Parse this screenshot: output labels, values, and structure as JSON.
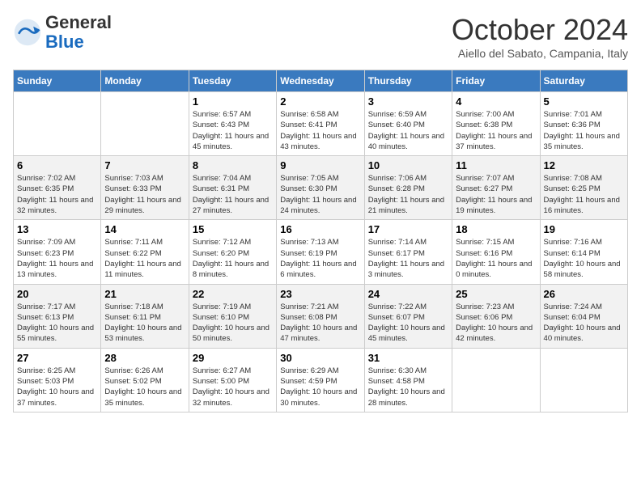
{
  "header": {
    "logo_general": "General",
    "logo_blue": "Blue",
    "month_title": "October 2024",
    "location": "Aiello del Sabato, Campania, Italy"
  },
  "days_of_week": [
    "Sunday",
    "Monday",
    "Tuesday",
    "Wednesday",
    "Thursday",
    "Friday",
    "Saturday"
  ],
  "weeks": [
    [
      {
        "day": "",
        "info": ""
      },
      {
        "day": "",
        "info": ""
      },
      {
        "day": "1",
        "info": "Sunrise: 6:57 AM\nSunset: 6:43 PM\nDaylight: 11 hours and 45 minutes."
      },
      {
        "day": "2",
        "info": "Sunrise: 6:58 AM\nSunset: 6:41 PM\nDaylight: 11 hours and 43 minutes."
      },
      {
        "day": "3",
        "info": "Sunrise: 6:59 AM\nSunset: 6:40 PM\nDaylight: 11 hours and 40 minutes."
      },
      {
        "day": "4",
        "info": "Sunrise: 7:00 AM\nSunset: 6:38 PM\nDaylight: 11 hours and 37 minutes."
      },
      {
        "day": "5",
        "info": "Sunrise: 7:01 AM\nSunset: 6:36 PM\nDaylight: 11 hours and 35 minutes."
      }
    ],
    [
      {
        "day": "6",
        "info": "Sunrise: 7:02 AM\nSunset: 6:35 PM\nDaylight: 11 hours and 32 minutes."
      },
      {
        "day": "7",
        "info": "Sunrise: 7:03 AM\nSunset: 6:33 PM\nDaylight: 11 hours and 29 minutes."
      },
      {
        "day": "8",
        "info": "Sunrise: 7:04 AM\nSunset: 6:31 PM\nDaylight: 11 hours and 27 minutes."
      },
      {
        "day": "9",
        "info": "Sunrise: 7:05 AM\nSunset: 6:30 PM\nDaylight: 11 hours and 24 minutes."
      },
      {
        "day": "10",
        "info": "Sunrise: 7:06 AM\nSunset: 6:28 PM\nDaylight: 11 hours and 21 minutes."
      },
      {
        "day": "11",
        "info": "Sunrise: 7:07 AM\nSunset: 6:27 PM\nDaylight: 11 hours and 19 minutes."
      },
      {
        "day": "12",
        "info": "Sunrise: 7:08 AM\nSunset: 6:25 PM\nDaylight: 11 hours and 16 minutes."
      }
    ],
    [
      {
        "day": "13",
        "info": "Sunrise: 7:09 AM\nSunset: 6:23 PM\nDaylight: 11 hours and 13 minutes."
      },
      {
        "day": "14",
        "info": "Sunrise: 7:11 AM\nSunset: 6:22 PM\nDaylight: 11 hours and 11 minutes."
      },
      {
        "day": "15",
        "info": "Sunrise: 7:12 AM\nSunset: 6:20 PM\nDaylight: 11 hours and 8 minutes."
      },
      {
        "day": "16",
        "info": "Sunrise: 7:13 AM\nSunset: 6:19 PM\nDaylight: 11 hours and 6 minutes."
      },
      {
        "day": "17",
        "info": "Sunrise: 7:14 AM\nSunset: 6:17 PM\nDaylight: 11 hours and 3 minutes."
      },
      {
        "day": "18",
        "info": "Sunrise: 7:15 AM\nSunset: 6:16 PM\nDaylight: 11 hours and 0 minutes."
      },
      {
        "day": "19",
        "info": "Sunrise: 7:16 AM\nSunset: 6:14 PM\nDaylight: 10 hours and 58 minutes."
      }
    ],
    [
      {
        "day": "20",
        "info": "Sunrise: 7:17 AM\nSunset: 6:13 PM\nDaylight: 10 hours and 55 minutes."
      },
      {
        "day": "21",
        "info": "Sunrise: 7:18 AM\nSunset: 6:11 PM\nDaylight: 10 hours and 53 minutes."
      },
      {
        "day": "22",
        "info": "Sunrise: 7:19 AM\nSunset: 6:10 PM\nDaylight: 10 hours and 50 minutes."
      },
      {
        "day": "23",
        "info": "Sunrise: 7:21 AM\nSunset: 6:08 PM\nDaylight: 10 hours and 47 minutes."
      },
      {
        "day": "24",
        "info": "Sunrise: 7:22 AM\nSunset: 6:07 PM\nDaylight: 10 hours and 45 minutes."
      },
      {
        "day": "25",
        "info": "Sunrise: 7:23 AM\nSunset: 6:06 PM\nDaylight: 10 hours and 42 minutes."
      },
      {
        "day": "26",
        "info": "Sunrise: 7:24 AM\nSunset: 6:04 PM\nDaylight: 10 hours and 40 minutes."
      }
    ],
    [
      {
        "day": "27",
        "info": "Sunrise: 6:25 AM\nSunset: 5:03 PM\nDaylight: 10 hours and 37 minutes."
      },
      {
        "day": "28",
        "info": "Sunrise: 6:26 AM\nSunset: 5:02 PM\nDaylight: 10 hours and 35 minutes."
      },
      {
        "day": "29",
        "info": "Sunrise: 6:27 AM\nSunset: 5:00 PM\nDaylight: 10 hours and 32 minutes."
      },
      {
        "day": "30",
        "info": "Sunrise: 6:29 AM\nSunset: 4:59 PM\nDaylight: 10 hours and 30 minutes."
      },
      {
        "day": "31",
        "info": "Sunrise: 6:30 AM\nSunset: 4:58 PM\nDaylight: 10 hours and 28 minutes."
      },
      {
        "day": "",
        "info": ""
      },
      {
        "day": "",
        "info": ""
      }
    ]
  ]
}
